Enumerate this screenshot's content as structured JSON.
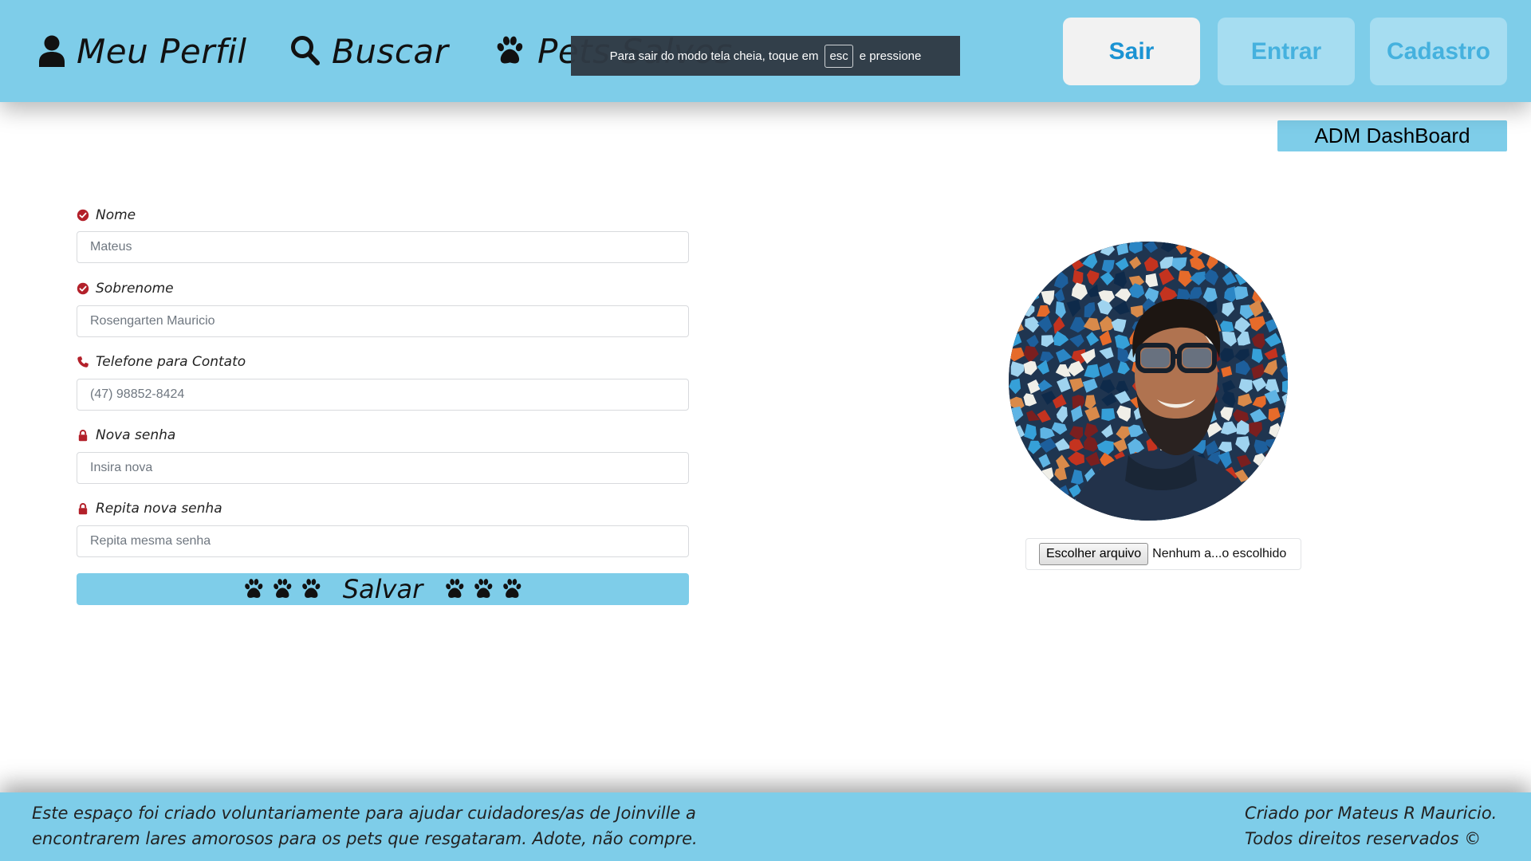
{
  "nav": {
    "profile_label": "Meu Perfil",
    "search_label": "Buscar",
    "pets_label": "Pets Salvos"
  },
  "fullscreen_notice": {
    "prefix": "Para sair do modo tela cheia, toque em",
    "key": "esc",
    "suffix": "e pressione"
  },
  "auth_buttons": {
    "logout": "Sair",
    "login": "Entrar",
    "register": "Cadastro"
  },
  "admin_button": "ADM DashBoard",
  "form": {
    "fields": [
      {
        "label": "Nome",
        "icon": "check-circle-icon",
        "placeholder": "Mateus"
      },
      {
        "label": "Sobrenome",
        "icon": "check-circle-icon",
        "placeholder": "Rosengarten Mauricio"
      },
      {
        "label": "Telefone para Contato",
        "icon": "phone-icon",
        "placeholder": "(47) 98852-8424"
      },
      {
        "label": "Nova senha",
        "icon": "lock-icon",
        "placeholder": "Insira nova"
      },
      {
        "label": "Repita nova senha",
        "icon": "lock-icon",
        "placeholder": "Repita mesma senha"
      }
    ],
    "save_label": "Salvar"
  },
  "upload": {
    "button_label": "Escolher arquivo",
    "status": "Nenhum a...o escolhido"
  },
  "footer": {
    "left_line1": "Este espaço foi criado voluntariamente para ajudar cuidadores/as de Joinville a",
    "left_line2": "encontrarem lares amorosos para os pets que resgataram. Adote, não compre.",
    "right_line1": "Criado por Mateus R Mauricio.",
    "right_line2": "Todos direitos reservados ©"
  },
  "colors": {
    "accent": "#7ecde9",
    "logout_text": "#1b93d3",
    "inactive_button": "#a6ddf1",
    "icon_red": "#b3202a"
  }
}
